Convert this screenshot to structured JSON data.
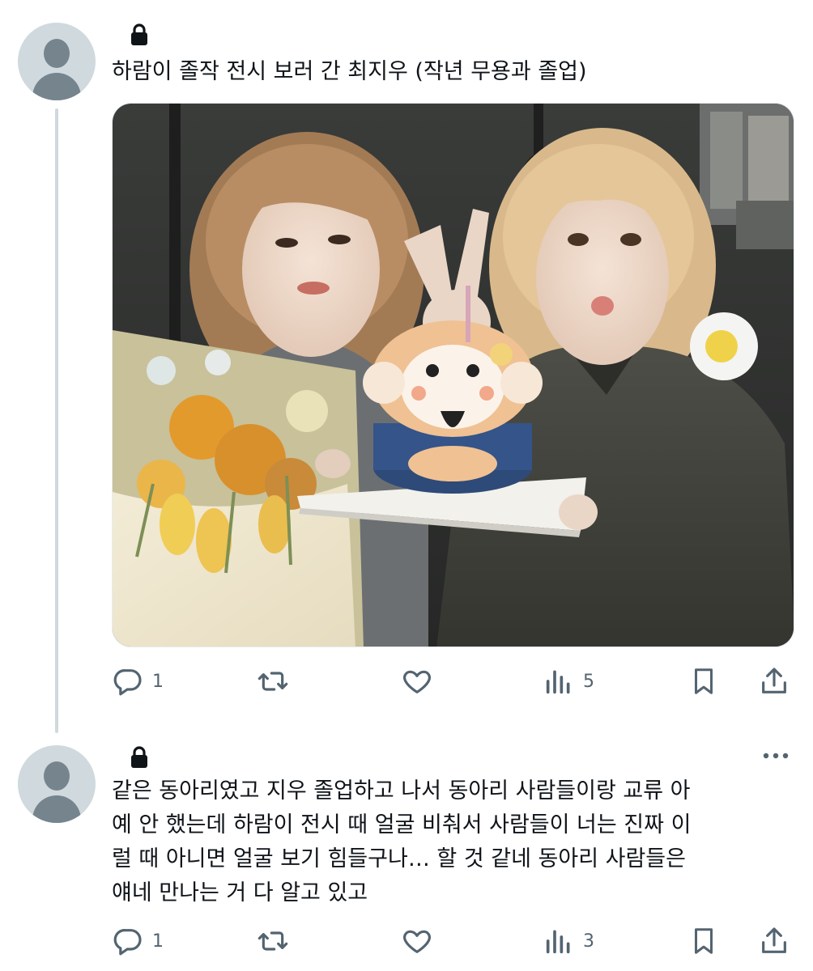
{
  "tweets": [
    {
      "text": "하람이 졸작 전시 보러 간 최지우 (작년 무용과 졸업)",
      "stats": {
        "replies": "1",
        "views": "5"
      }
    },
    {
      "text": "같은 동아리였고 지우 졸업하고 나서 동아리 사람들이랑 교류 아\n예 안 했는데 하람이 전시 때 얼굴 비춰서 사람들이 너는 진짜 이\n럴 때 아니면 얼굴 보기 힘들구나… 할 것 같네 동아리 사람들은\n얘네 만나는 거 다 알고 있고",
      "stats": {
        "replies": "1",
        "views": "3"
      }
    }
  ],
  "icons": {
    "avatar": "default-avatar-icon",
    "protected": "lock-icon",
    "reply": "reply-icon",
    "retweet": "retweet-icon",
    "like": "heart-icon",
    "views": "views-icon",
    "bookmark": "bookmark-icon",
    "share": "share-icon",
    "more": "more-dots-icon"
  },
  "colors": {
    "text": "#0f1419",
    "icon_gray": "#536471",
    "avatar_bg": "#cfd9de",
    "avatar_fg": "#76848d",
    "thread_line": "#cfd9de"
  }
}
